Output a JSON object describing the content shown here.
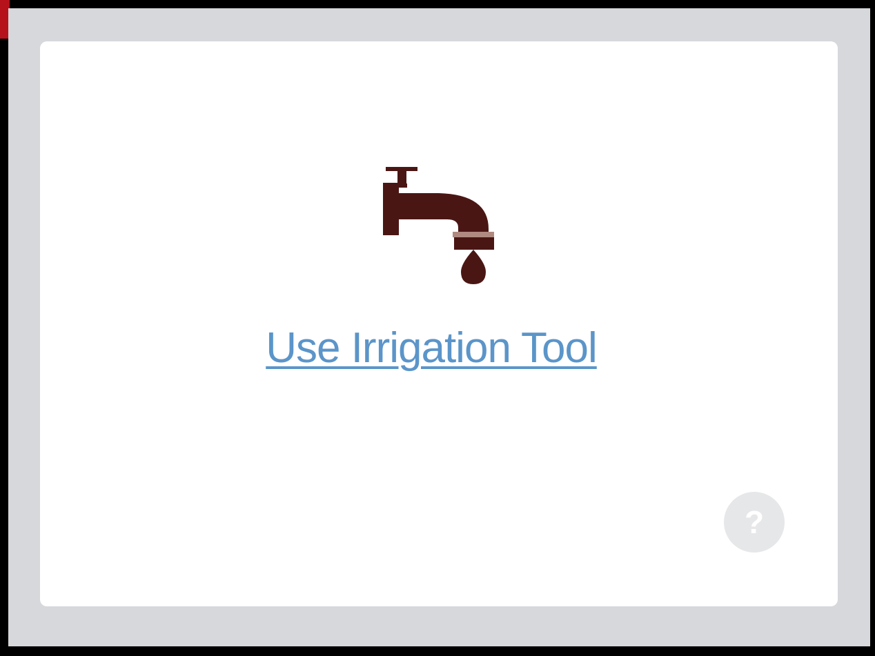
{
  "card": {
    "link_label": "Use Irrigation Tool",
    "icon": "water-tap-icon",
    "help_label": "?",
    "help_icon": "help-icon"
  },
  "colors": {
    "panel_background": "#d7d8dc",
    "card_background": "#ffffff",
    "icon": "#4a1614",
    "link": "#5b95c9",
    "help_button": "#e6e7e9"
  }
}
